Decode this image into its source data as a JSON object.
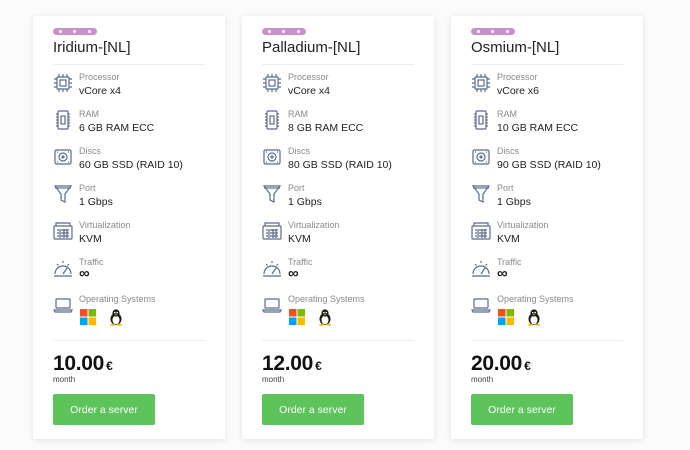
{
  "spec_labels": {
    "processor": "Processor",
    "ram": "RAM",
    "discs": "Discs",
    "port": "Port",
    "virtualization": "Virtualization",
    "traffic": "Traffic",
    "os": "Operating Systems"
  },
  "colors": {
    "accent_badge": "#c792c9",
    "button": "#5cc45b",
    "icon": "#5b6b8c"
  },
  "os_icons": [
    "windows-icon",
    "linux-tux-icon"
  ],
  "plans": [
    {
      "title": "Iridium-[NL]",
      "processor": "vCore x4",
      "ram": "6 GB RAM ECC",
      "discs": "60 GB SSD (RAID 10)",
      "port": "1 Gbps",
      "virtualization": "KVM",
      "traffic": "∞",
      "price": "10.00",
      "currency": "€",
      "period": "month",
      "order_label": "Order a server"
    },
    {
      "title": "Palladium-[NL]",
      "processor": "vCore x4",
      "ram": "8 GB RAM ECC",
      "discs": "80 GB SSD (RAID 10)",
      "port": "1 Gbps",
      "virtualization": "KVM",
      "traffic": "∞",
      "price": "12.00",
      "currency": "€",
      "period": "month",
      "order_label": "Order a server"
    },
    {
      "title": "Osmium-[NL]",
      "processor": "vCore x6",
      "ram": "10 GB RAM ECC",
      "discs": "90 GB SSD (RAID 10)",
      "port": "1 Gbps",
      "virtualization": "KVM",
      "traffic": "∞",
      "price": "20.00",
      "currency": "€",
      "period": "month",
      "order_label": "Order a server"
    }
  ]
}
